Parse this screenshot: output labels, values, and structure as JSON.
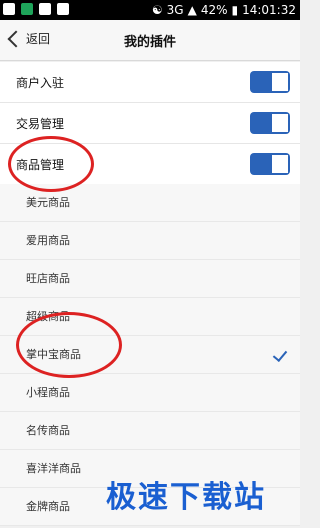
{
  "status_bar": {
    "network": "3G",
    "battery": "42%",
    "time": "14:01:32"
  },
  "nav": {
    "back_label": "返回",
    "title": "我的插件"
  },
  "toggles": [
    {
      "label": "商户入驻",
      "on": true
    },
    {
      "label": "交易管理",
      "on": true
    },
    {
      "label": "商品管理",
      "on": true
    }
  ],
  "sub_items": [
    {
      "label": "美元商品",
      "checked": false
    },
    {
      "label": "爱用商品",
      "checked": false
    },
    {
      "label": "旺店商品",
      "checked": false
    },
    {
      "label": "超级商品",
      "checked": false
    },
    {
      "label": "掌中宝商品",
      "checked": true
    },
    {
      "label": "小程商品",
      "checked": false
    },
    {
      "label": "名传商品",
      "checked": false
    },
    {
      "label": "喜洋洋商品",
      "checked": false
    },
    {
      "label": "金牌商品",
      "checked": false
    }
  ],
  "watermark": "极速下载站",
  "accent_color": "#2a63b8",
  "annotation_color": "#dd2222"
}
